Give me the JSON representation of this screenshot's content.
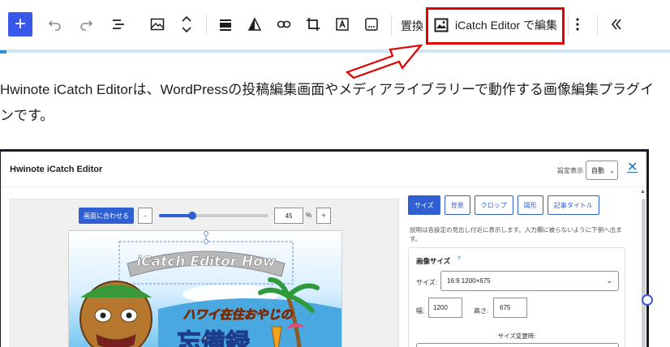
{
  "toolbar": {
    "add_block_label": "+",
    "replace_label": "置換",
    "icatch_label": "iCatch Editor で編集"
  },
  "paragraph": {
    "text": "Hwinote iCatch Editorは、WordPressの投稿編集画面やメディアライブラリーで動作する画像編集プラグインです。"
  },
  "editor": {
    "title": "Hwinote iCatch Editor",
    "view_label": "設定表示",
    "view_value": "自動",
    "close_label": "✕",
    "fit_button": "画面に合わせる",
    "minus_label": "-",
    "plus_label": "+",
    "zoom_value": "45",
    "zoom_unit": "%",
    "zoom_level": 0.3,
    "tabs": [
      {
        "label": "サイズ",
        "active": true
      },
      {
        "label": "背景",
        "active": false
      },
      {
        "label": "クロップ",
        "active": false
      },
      {
        "label": "図形",
        "active": false
      },
      {
        "label": "記事タイトル",
        "active": false
      }
    ],
    "help_text": "説明は各設定の見出し付近に表示します。入力欄に被らないように下側へ出ます。",
    "image_size": {
      "title": "画像サイズ",
      "help_mark": "?",
      "size_label": "サイズ:",
      "size_value": "16:9 1200×675",
      "width_label": "幅:",
      "width_value": "1200",
      "height_label": "高さ:",
      "height_value": "675",
      "resize_label": "サイズ変更時:"
    },
    "preview": {
      "banner_text": "iCatch Editor How",
      "title_line1": "ハワイ在住おやじの",
      "title_line2": "忘備録"
    }
  },
  "colors": {
    "accent": "#3858e9",
    "highlight_box": "#e00000",
    "editor_blue": "#2f5fd0"
  }
}
